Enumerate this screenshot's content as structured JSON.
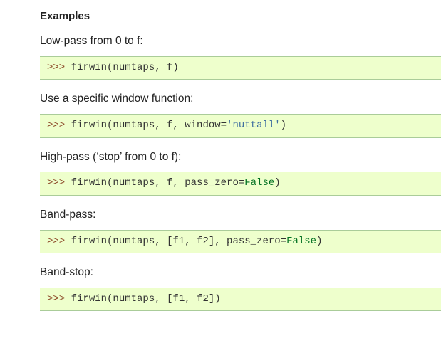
{
  "section_title": "Examples",
  "examples": [
    {
      "desc": "Low-pass from 0 to f:",
      "code": {
        "prompt": ">>> ",
        "call": "firwin(numtaps, f)"
      }
    },
    {
      "desc": "Use a specific window function:",
      "code": {
        "prompt": ">>> ",
        "pre": "firwin(numtaps, f, window=",
        "str": "'nuttall'",
        "post": ")"
      }
    },
    {
      "desc": "High-pass (‘stop’ from 0 to f):",
      "code": {
        "prompt": ">>> ",
        "pre": "firwin(numtaps, f, pass_zero=",
        "kw": "False",
        "post": ")"
      }
    },
    {
      "desc": "Band-pass:",
      "code": {
        "prompt": ">>> ",
        "pre": "firwin(numtaps, [f1, f2], pass_zero=",
        "kw": "False",
        "post": ")"
      }
    },
    {
      "desc": "Band-stop:",
      "code": {
        "prompt": ">>> ",
        "call": "firwin(numtaps, [f1, f2])"
      }
    }
  ]
}
